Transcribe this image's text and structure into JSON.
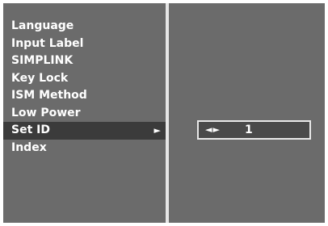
{
  "menu": {
    "items": [
      {
        "label": "Language"
      },
      {
        "label": "Input Label"
      },
      {
        "label": "SIMPLINK"
      },
      {
        "label": "Key Lock"
      },
      {
        "label": "ISM Method"
      },
      {
        "label": "Low Power"
      },
      {
        "label": "Set ID",
        "selected": true,
        "submenu_arrow": "►"
      },
      {
        "label": "Index"
      }
    ]
  },
  "set_id": {
    "adjust_icon": "◄►",
    "value": "1"
  },
  "colors": {
    "panel": "#6b6b6b",
    "selected_row": "#3b3b3b",
    "text": "#ffffff",
    "divider": "#e6e6e6"
  },
  "icons": {
    "submenu_arrow": "right-triangle-icon",
    "adjust": "left-right-arrows-icon"
  }
}
